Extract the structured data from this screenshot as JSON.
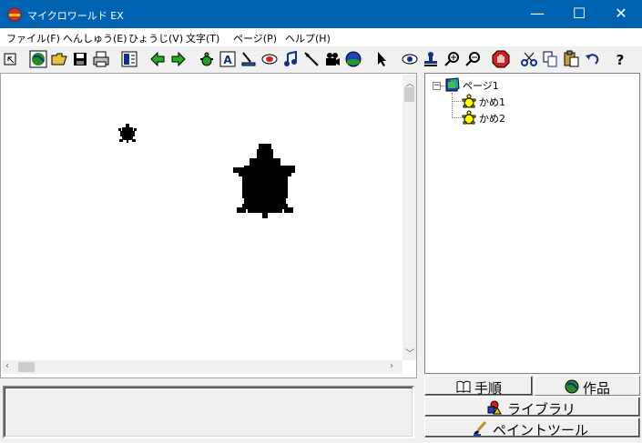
{
  "window": {
    "title": "マイクロワールド EX",
    "minimize_glyph": "—",
    "maximize_glyph": "☐",
    "close_glyph": "✕"
  },
  "menu": {
    "file": "ファイル(F)",
    "edit": "へんしゅう(E)",
    "view": "ひょうじ(V)",
    "text": "文字(T)",
    "page": "ページ(P)",
    "help": "ヘルプ(H)"
  },
  "toolbar": {
    "icons": [
      "select-arrow-icon",
      "globe-icon",
      "open-folder-icon",
      "save-disk-icon",
      "print-icon",
      "layout-icon",
      "back-arrow-icon",
      "forward-arrow-icon",
      "new-turtle-icon",
      "text-box-icon",
      "paint-icon",
      "button-icon",
      "music-icon",
      "slider-icon",
      "movie-icon",
      "globe-blue-icon",
      "pointer-icon",
      "eye-icon",
      "stamp-icon",
      "zoom-in-icon",
      "zoom-out-icon",
      "stop-hand-icon",
      "cut-icon",
      "copy-icon",
      "paste-icon",
      "undo-icon",
      "help-icon"
    ]
  },
  "tree": {
    "page": "ページ1",
    "turtles": [
      "かめ1",
      "かめ2"
    ],
    "expander": "−"
  },
  "status": {
    "text": ""
  },
  "tabs": {
    "procedures": "手順",
    "project": "作品",
    "library": "ライブラリ",
    "paint_tools": "ペイントツール"
  },
  "colors": {
    "titlebar": "#0063b1",
    "turtle_yellow": "#ffff00"
  }
}
